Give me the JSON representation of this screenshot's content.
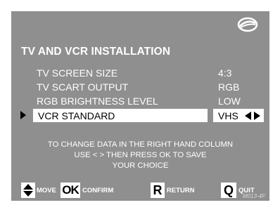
{
  "screen": {
    "title": "TV AND VCR INSTALLATION",
    "items": [
      {
        "label": "TV SCREEN SIZE",
        "value": "4:3"
      },
      {
        "label": "TV SCART OUTPUT",
        "value": "RGB"
      },
      {
        "label": "RGB BRIGHTNESS LEVEL",
        "value": "LOW"
      },
      {
        "label": "VCR STANDARD",
        "value": "VHS",
        "selected": true
      }
    ],
    "instructions": [
      "TO CHANGE DATA IN THE RIGHT HAND COLUMN",
      "USE < > THEN PRESS OK TO SAVE",
      "YOUR CHOICE"
    ],
    "keys": {
      "move": {
        "label": "MOVE"
      },
      "confirm": {
        "badge": "OK",
        "label": "CONFIRM"
      },
      "return": {
        "badge": "R",
        "label": "RETURN"
      },
      "quit": {
        "badge": "Q",
        "label": "QUIT"
      }
    },
    "ref": "M013-4F",
    "icons": [
      "brand-logo-icon",
      "selection-pointer-icon",
      "left-right-arrows-icon",
      "up-down-arrows-icon"
    ],
    "colors": {
      "background": "#8f8f8f",
      "text": "#ffffff",
      "highlight": "#ffffff",
      "selected_text": "#000000"
    }
  }
}
